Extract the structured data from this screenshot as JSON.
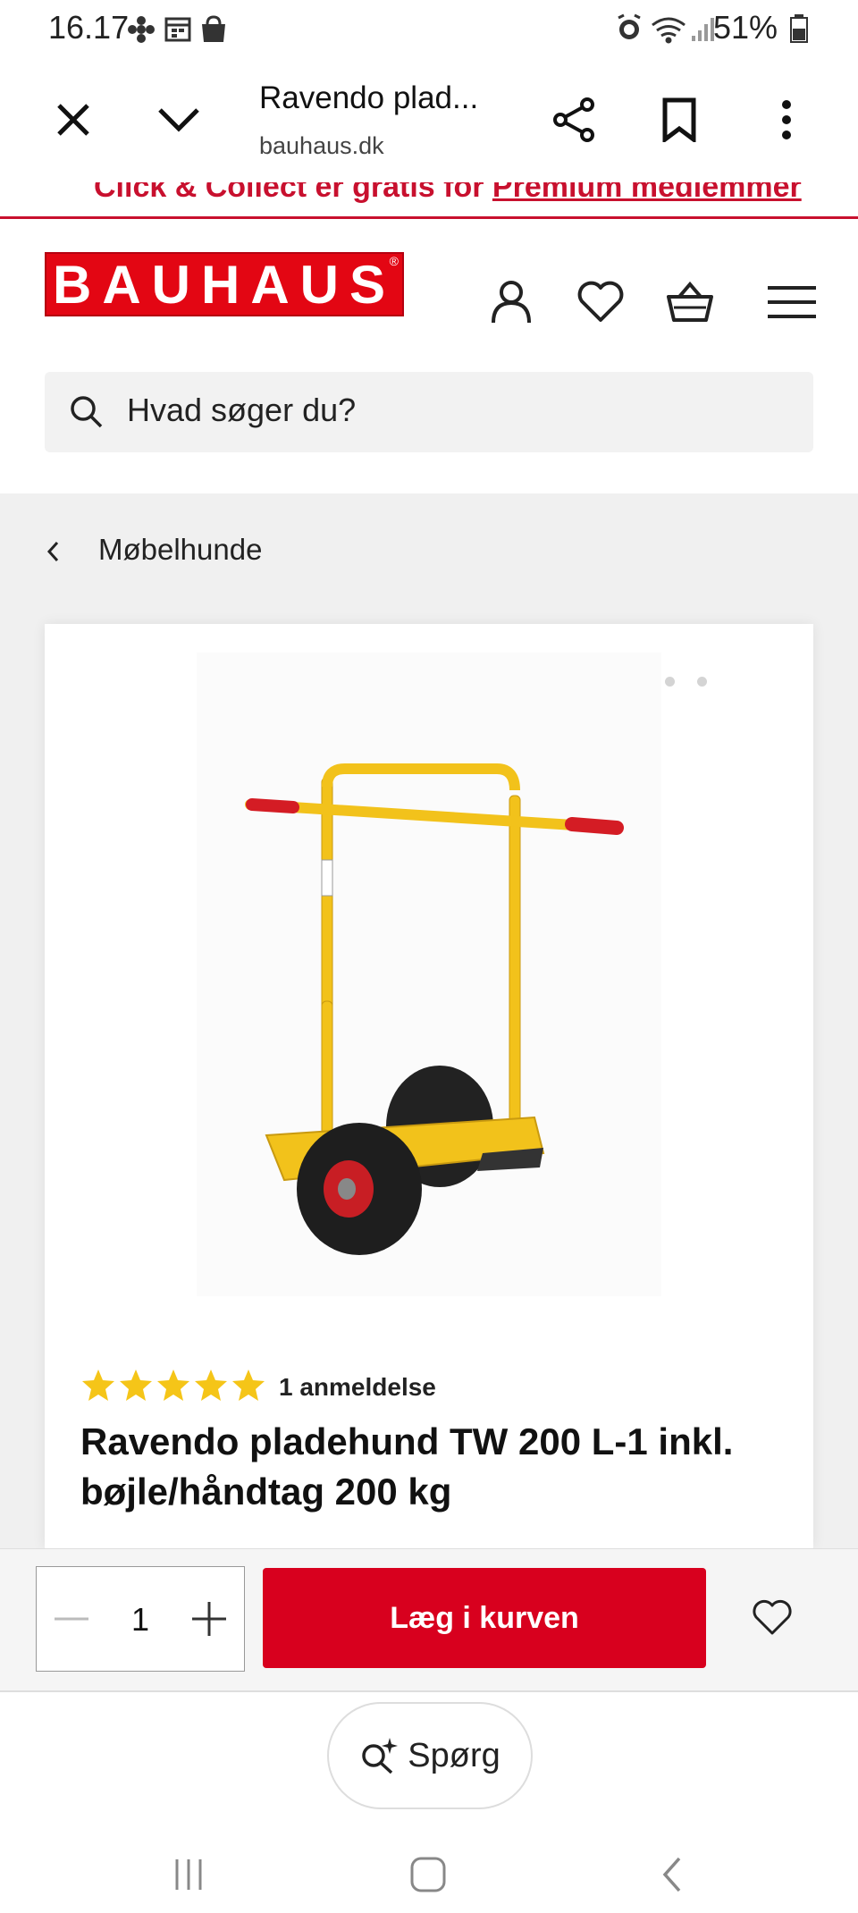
{
  "status_bar": {
    "time": "16.17",
    "battery": "51%"
  },
  "browser": {
    "title": "Ravendo plad...",
    "domain": "bauhaus.dk"
  },
  "promo": {
    "text_prefix": "Click & Collect er gratis for ",
    "link_text": "Premium medlemmer"
  },
  "header": {
    "logo_text": "BAUHAUS",
    "logo_mark": "®"
  },
  "search": {
    "placeholder": "Hvad søger du?"
  },
  "breadcrumb": {
    "label": "Møbelhunde"
  },
  "gallery": {
    "image_count": 3,
    "active_index": 0
  },
  "product": {
    "rating": 5,
    "reviews": "1 anmeldelse",
    "title": "Ravendo pladehund TW 200 L-1 inkl. bøjle/håndtag 200 kg"
  },
  "cart": {
    "quantity": "1",
    "add_label": "Læg i kurven"
  },
  "ask": {
    "label": "Spørg"
  },
  "colors": {
    "brand": "#e30613",
    "button": "#d8001e",
    "promo": "#c8102e",
    "product_yellow": "#f2c21b"
  }
}
